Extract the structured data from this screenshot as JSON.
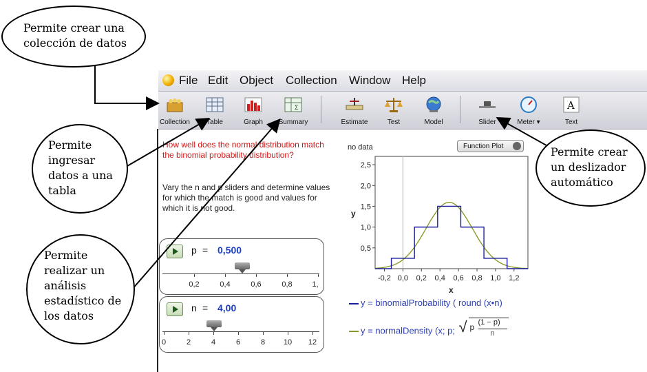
{
  "menu": {
    "items": [
      "File",
      "Edit",
      "Object",
      "Collection",
      "Window",
      "Help"
    ]
  },
  "toolbar": {
    "tools": [
      {
        "label": "Collection",
        "icon": "collection-icon"
      },
      {
        "label": "Table",
        "icon": "table-icon"
      },
      {
        "label": "Graph",
        "icon": "graph-icon"
      },
      {
        "label": "Summary",
        "icon": "summary-icon"
      },
      {
        "label": "Estimate",
        "icon": "estimate-icon"
      },
      {
        "label": "Test",
        "icon": "test-icon"
      },
      {
        "label": "Model",
        "icon": "model-icon"
      },
      {
        "label": "Slider",
        "icon": "slider-icon"
      },
      {
        "label": "Meter ▾",
        "icon": "meter-icon"
      },
      {
        "label": "Text",
        "icon": "text-icon"
      }
    ]
  },
  "text_tile": {
    "question": "How well does the normal distribution match the binomial probability distribution?",
    "instructions": "Vary the n and p sliders and determine values for which the match is good and values for which it is not good."
  },
  "slider_p": {
    "variable": "p",
    "equals": "=",
    "value": "0,500",
    "value_num": 0.5,
    "tick_labels": [
      "0,2",
      "0,4",
      "0,6",
      "0,8",
      "1,"
    ]
  },
  "slider_n": {
    "variable": "n",
    "equals": "=",
    "value": "4,00",
    "value_num": 4,
    "tick_labels": [
      "0",
      "2",
      "4",
      "6",
      "8",
      "10",
      "12"
    ]
  },
  "graph": {
    "no_data": "no data",
    "plot_menu": "Function Plot",
    "ylabel": "y",
    "xlabel": "x",
    "legend1": "y = binomialProbability ( round (x•n)",
    "legend2_prefix": "y = normalDensity (x; p;",
    "legend2_frac_num": "(1 − p)",
    "legend2_frac_den": "n",
    "legend2_sqrt_p": "p"
  },
  "chart_data": {
    "type": "line",
    "xlabel": "x",
    "ylabel": "y",
    "xlim": [
      -0.3,
      1.35
    ],
    "ylim": [
      0,
      2.7
    ],
    "x_ticks": [
      "-0,2",
      "0,0",
      "0,2",
      "0,4",
      "0,6",
      "0,8",
      "1,0",
      "1,2"
    ],
    "y_ticks": [
      "0,5",
      "1,0",
      "1,5",
      "2,0",
      "2,5"
    ],
    "series": [
      {
        "name": "y = binomialProbability ( round (x•n)",
        "color": "#1b1b9a",
        "steps": [
          [
            -0.125,
            0.125,
            0.25
          ],
          [
            0.125,
            0.375,
            1.0
          ],
          [
            0.375,
            0.625,
            1.5
          ],
          [
            0.625,
            0.875,
            1.0
          ],
          [
            0.875,
            1.125,
            0.25
          ]
        ]
      },
      {
        "name": "y = normalDensity (x; p; √(p(1 − p)/n))",
        "color": "#8a9a2a",
        "mean": 0.5,
        "sd": 0.25
      }
    ]
  },
  "callouts": {
    "collection": "Permite crear una colección de datos",
    "table": "Permite ingresar datos a una tabla",
    "summary": "Permite realizar un análisis estadístico de los datos",
    "slider": "Permite crear un deslizador automático"
  },
  "colors": {
    "question": "#d01818",
    "value": "#1b3ec8",
    "binomial": "#1b1b9a",
    "normal": "#8a9a2a"
  }
}
